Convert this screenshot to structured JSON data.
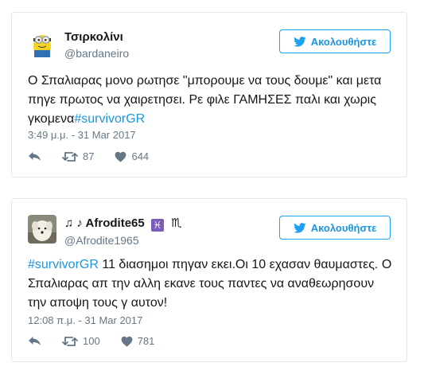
{
  "tweets": [
    {
      "display_name": "Τσιρκολίνι",
      "handle": "@bardaneiro",
      "follow_label": "Ακολουθήστε",
      "text_main": "Ο Σπαλιαρας μονο ρωτησε \"μπορουμε να τους δουμε\" και μετα πηγε πρωτος να χαιρετησει. Ρε φιλε ΓΑΜΗΣΕΣ παλι και χωρις γκομενα",
      "hashtag": "#survivorGR",
      "timestamp": "3:49 μ.μ. - 31 Mar 2017",
      "retweets": "87",
      "likes": "644",
      "avatar_icon": "minion-avatar"
    },
    {
      "display_name_notes": "♫ ♪",
      "display_name": "Afrodite65",
      "display_name_symbol1": "♓",
      "display_name_symbol2": "♏",
      "handle": "@Afrodite1965",
      "follow_label": "Ακολουθήστε",
      "hashtag": "#survivorGR",
      "text_main": " 11 διασημοι πηγαν εκει.Οι 10 εχασαν θαυμαστες. Ο Σπαλιαρας απ την αλλη εκανε τους παντες να αναθεωρησουν την αποψη τους γ αυτον!",
      "timestamp": "12:08 π.μ. - 31 Mar 2017",
      "retweets": "100",
      "likes": "781",
      "avatar_icon": "dog-photo-avatar"
    }
  ],
  "colors": {
    "accent": "#1da1f2",
    "link": "#1b95e0",
    "muted": "#657786",
    "border": "#e1e8ed"
  }
}
